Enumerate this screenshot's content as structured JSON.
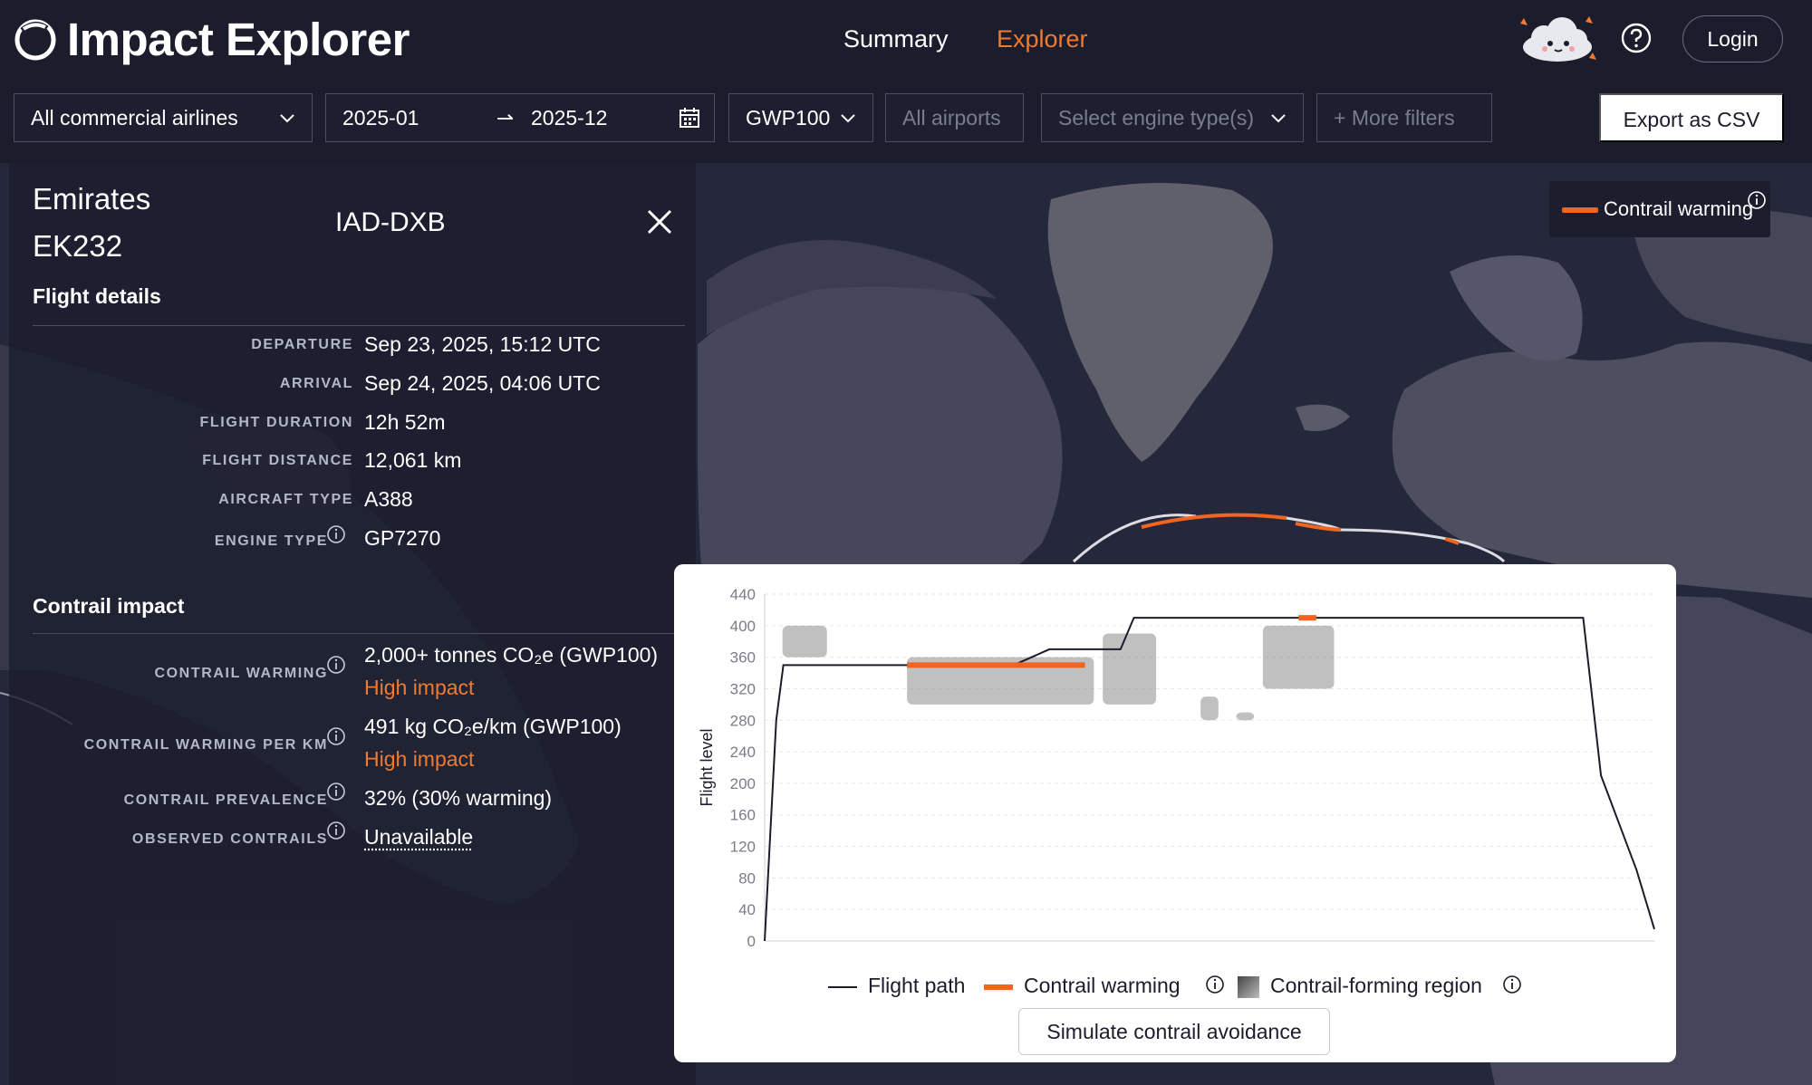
{
  "app": {
    "title": "Impact Explorer",
    "nav": {
      "summary": "Summary",
      "explorer": "Explorer"
    },
    "login_label": "Login"
  },
  "filters": {
    "airlines": "All commercial airlines",
    "date_from": "2025-01",
    "date_to": "2025-12",
    "date_arrow": "⇀",
    "gwp": "GWP100",
    "airports_placeholder": "All airports",
    "engine_placeholder": "Select engine type(s)",
    "more_filters": "+ More filters",
    "export_label": "Export as CSV"
  },
  "flight": {
    "airline": "Emirates",
    "flight_number": "EK232",
    "route": "IAD-DXB",
    "details_title": "Flight details",
    "details": [
      {
        "label": "DEPARTURE",
        "value": "Sep 23, 2025, 15:12 UTC"
      },
      {
        "label": "ARRIVAL",
        "value": "Sep 24, 2025, 04:06 UTC"
      },
      {
        "label": "FLIGHT DURATION",
        "value": "12h 52m"
      },
      {
        "label": "FLIGHT DISTANCE",
        "value": "12,061 km"
      },
      {
        "label": "AIRCRAFT TYPE",
        "value": "A388"
      },
      {
        "label": "ENGINE TYPE",
        "value": "GP7270"
      }
    ],
    "impact_title": "Contrail impact",
    "impact": {
      "warming_label": "CONTRAIL WARMING",
      "warming_value": "2,000+ tonnes CO₂e (GWP100)",
      "warming_rating": "High impact",
      "per_km_label": "CONTRAIL WARMING PER KM",
      "per_km_value": "491 kg CO₂e/km (GWP100)",
      "per_km_rating": "High impact",
      "prevalence_label": "CONTRAIL PREVALENCE",
      "prevalence_value": "32% (30% warming)",
      "observed_label": "OBSERVED CONTRAILS",
      "observed_value": "Unavailable"
    }
  },
  "map_legend": {
    "label": "Contrail warming"
  },
  "chart_data": {
    "type": "line",
    "ylabel": "Flight level",
    "xlabel": "",
    "ylim": [
      0,
      440
    ],
    "yticks": [
      0,
      40,
      80,
      120,
      160,
      200,
      240,
      280,
      320,
      360,
      400,
      440
    ],
    "flight_path": [
      [
        0,
        0
      ],
      [
        0.013,
        280
      ],
      [
        0.021,
        350
      ],
      [
        0.28,
        350
      ],
      [
        0.32,
        370
      ],
      [
        0.4,
        370
      ],
      [
        0.415,
        410
      ],
      [
        0.92,
        410
      ],
      [
        0.94,
        210
      ],
      [
        0.98,
        90
      ],
      [
        1.0,
        15
      ]
    ],
    "contrail_warming_segments": [
      {
        "x0": 0.16,
        "x1": 0.36,
        "y": 350
      },
      {
        "x0": 0.6,
        "x1": 0.62,
        "y": 410
      }
    ],
    "contrail_regions": [
      {
        "x0": 0.02,
        "x1": 0.07,
        "y0": 360,
        "y1": 400
      },
      {
        "x0": 0.16,
        "x1": 0.37,
        "y0": 300,
        "y1": 360
      },
      {
        "x0": 0.38,
        "x1": 0.44,
        "y0": 300,
        "y1": 390
      },
      {
        "x0": 0.49,
        "x1": 0.51,
        "y0": 280,
        "y1": 310
      },
      {
        "x0": 0.53,
        "x1": 0.55,
        "y0": 280,
        "y1": 290
      },
      {
        "x0": 0.56,
        "x1": 0.64,
        "y0": 320,
        "y1": 400
      }
    ],
    "legend": {
      "flight_path": "Flight path",
      "contrail_warming": "Contrail warming",
      "contrail_region": "Contrail-forming region"
    },
    "colors": {
      "path": "#1b1c2c",
      "warming": "#f0651f",
      "region": "#8c8c8c"
    }
  },
  "actions": {
    "simulate": "Simulate contrail avoidance"
  },
  "colors": {
    "accent": "#f27a30",
    "background": "#1b1c2c"
  }
}
